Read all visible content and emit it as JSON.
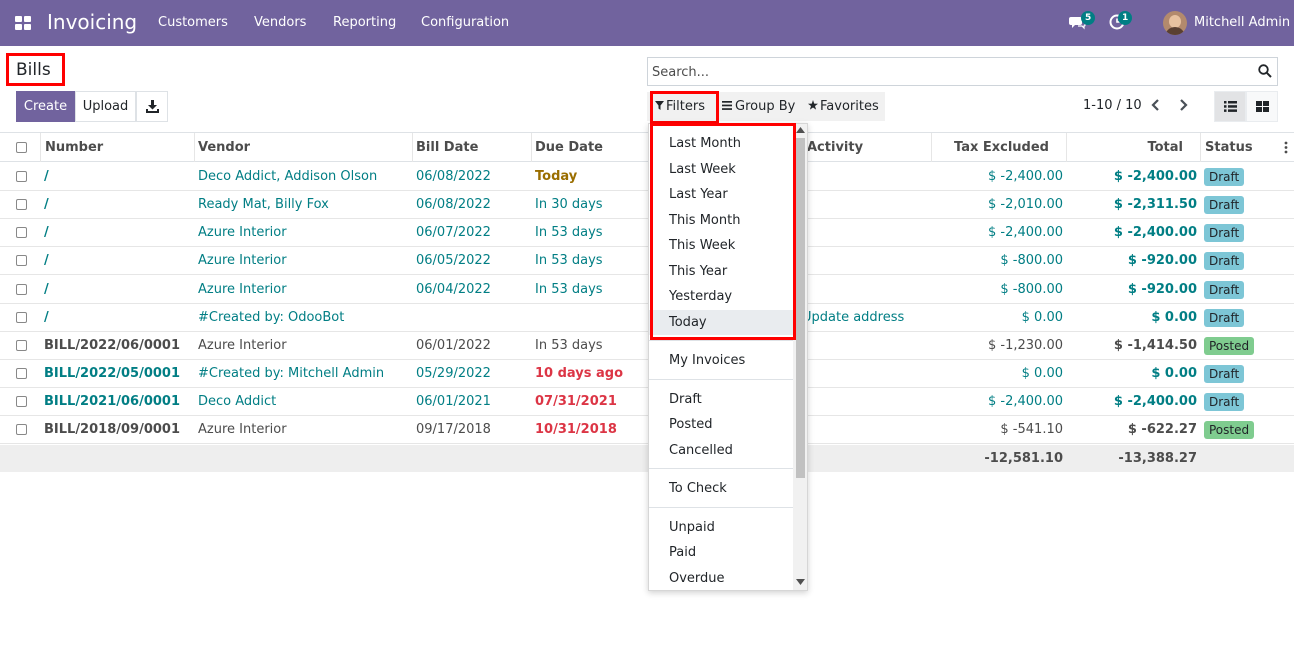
{
  "navbar": {
    "app_name": "Invoicing",
    "menu": [
      "Customers",
      "Vendors",
      "Reporting",
      "Configuration"
    ],
    "messages_count": "5",
    "activities_count": "1",
    "user_name": "Mitchell Admin"
  },
  "page": {
    "title": "Bills",
    "create_label": "Create",
    "upload_label": "Upload"
  },
  "search": {
    "placeholder": "Search..."
  },
  "filter_bar": {
    "filters_label": "Filters",
    "groupby_label": "Group By",
    "favorites_label": "Favorites"
  },
  "pager": {
    "range": "1-10 / 10"
  },
  "table": {
    "columns": [
      "Number",
      "Vendor",
      "Bill Date",
      "Due Date",
      "Activity",
      "Tax Excluded",
      "Total",
      "Status"
    ],
    "rows": [
      {
        "number": "/",
        "vendor": "Deco Addict, Addison Olson",
        "bill_date": "06/08/2022",
        "due_date": "Today",
        "activity": "",
        "tax_excluded": "$ -2,400.00",
        "total": "$ -2,400.00",
        "status": "Draft"
      },
      {
        "number": "/",
        "vendor": "Ready Mat, Billy Fox",
        "bill_date": "06/08/2022",
        "due_date": "In 30 days",
        "activity": "",
        "tax_excluded": "$ -2,010.00",
        "total": "$ -2,311.50",
        "status": "Draft"
      },
      {
        "number": "/",
        "vendor": "Azure Interior",
        "bill_date": "06/07/2022",
        "due_date": "In 53 days",
        "activity": "",
        "tax_excluded": "$ -2,400.00",
        "total": "$ -2,400.00",
        "status": "Draft"
      },
      {
        "number": "/",
        "vendor": "Azure Interior",
        "bill_date": "06/05/2022",
        "due_date": "In 53 days",
        "activity": "",
        "tax_excluded": "$ -800.00",
        "total": "$ -920.00",
        "status": "Draft"
      },
      {
        "number": "/",
        "vendor": "Azure Interior",
        "bill_date": "06/04/2022",
        "due_date": "In 53 days",
        "activity": "",
        "tax_excluded": "$ -800.00",
        "total": "$ -920.00",
        "status": "Draft"
      },
      {
        "number": "/",
        "vendor": "#Created by: OdooBot",
        "bill_date": "",
        "due_date": "",
        "activity": "Update address",
        "tax_excluded": "$ 0.00",
        "total": "$ 0.00",
        "status": "Draft"
      },
      {
        "number": "BILL/2022/06/0001",
        "vendor": "Azure Interior",
        "bill_date": "06/01/2022",
        "due_date": "In 53 days",
        "activity": "",
        "tax_excluded": "$ -1,230.00",
        "total": "$ -1,414.50",
        "status": "Posted"
      },
      {
        "number": "BILL/2022/05/0001",
        "vendor": "#Created by: Mitchell Admin",
        "bill_date": "05/29/2022",
        "due_date": "10 days ago",
        "activity": "",
        "tax_excluded": "$ 0.00",
        "total": "$ 0.00",
        "status": "Draft"
      },
      {
        "number": "BILL/2021/06/0001",
        "vendor": "Deco Addict",
        "bill_date": "06/01/2021",
        "due_date": "07/31/2021",
        "activity": "",
        "tax_excluded": "$ -2,400.00",
        "total": "$ -2,400.00",
        "status": "Draft"
      },
      {
        "number": "BILL/2018/09/0001",
        "vendor": "Azure Interior",
        "bill_date": "09/17/2018",
        "due_date": "10/31/2018",
        "activity": "",
        "tax_excluded": "$ -541.10",
        "total": "$ -622.27",
        "status": "Posted"
      }
    ],
    "totals": {
      "tax_excluded": "-12,581.10",
      "total": "-13,388.27"
    }
  },
  "filters_dropdown": {
    "date_filters": [
      "Last Month",
      "Last Week",
      "Last Year",
      "This Month",
      "This Week",
      "This Year",
      "Yesterday",
      "Today"
    ],
    "group2": [
      "My Invoices"
    ],
    "group3": [
      "Draft",
      "Posted",
      "Cancelled"
    ],
    "group4": [
      "To Check"
    ],
    "group5": [
      "Unpaid",
      "Paid",
      "Overdue"
    ]
  },
  "colors": {
    "brand": "#71639e",
    "link": "#017e84",
    "warning": "#9a6e00",
    "danger": "#dc3545",
    "draft_badge": "#7dc6d6",
    "posted_badge": "#7fcc8f",
    "highlight": "#ff0000"
  }
}
